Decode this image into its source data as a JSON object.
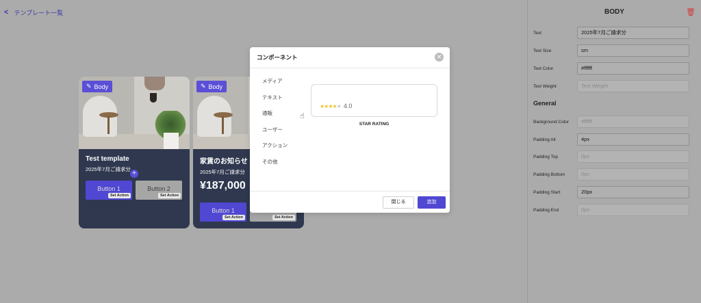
{
  "topbar": {
    "back_label": "テンプレート一覧"
  },
  "cards": [
    {
      "badge": "Body",
      "title": "Test template",
      "subtitle": "2025年7月ご請求分",
      "button1": "Button 1",
      "button2": "Button 2",
      "set_action": "Set Action"
    },
    {
      "badge": "Body",
      "title": "家賃のお知らせ",
      "subtitle": "2025年7月ご請求分",
      "price": "¥187,000",
      "button1": "Button 1",
      "button2": "Button 2",
      "set_action": "Set Action"
    }
  ],
  "modal": {
    "title": "コンポーネント",
    "menu": [
      "メディア",
      "テキスト",
      "通販",
      "ユーザー",
      "アクション",
      "その他"
    ],
    "preview_rating": "4.0",
    "preview_label": "STAR RATING",
    "cancel": "閉じる",
    "add": "追加"
  },
  "panel": {
    "title": "BODY",
    "section_general": "General",
    "fields": [
      {
        "label": "Text",
        "value": "2025年7月ご請求分",
        "placeholder": ""
      },
      {
        "label": "Text Size",
        "value": "sm",
        "placeholder": ""
      },
      {
        "label": "Text Color",
        "value": "#ffffff",
        "placeholder": ""
      },
      {
        "label": "Text Weight",
        "value": "",
        "placeholder": "Text Weight"
      },
      {
        "label": "Background Color",
        "value": "",
        "placeholder": "#ffffff"
      },
      {
        "label": "Padding All",
        "value": "4px",
        "placeholder": ""
      },
      {
        "label": "Padding Top",
        "value": "",
        "placeholder": "0px"
      },
      {
        "label": "Padding Bottom",
        "value": "",
        "placeholder": "0px"
      },
      {
        "label": "Padding Start",
        "value": "20px",
        "placeholder": ""
      },
      {
        "label": "Padding End",
        "value": "",
        "placeholder": "0px"
      }
    ]
  },
  "colors": {
    "accent": "#5047d2",
    "card_bg": "#2f384f",
    "danger": "#d23b3b"
  }
}
